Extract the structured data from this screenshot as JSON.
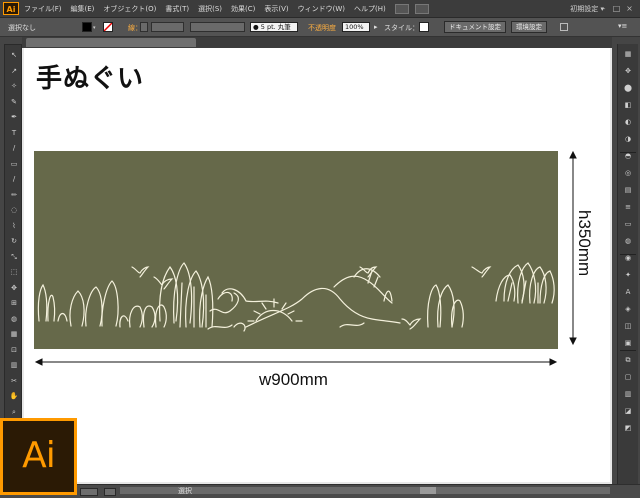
{
  "app": {
    "badge": "Ai",
    "logo_text": "Ai",
    "accent": "#ff9a00"
  },
  "menu": {
    "items": [
      "ファイル(F)",
      "編集(E)",
      "オブジェクト(O)",
      "書式(T)",
      "選択(S)",
      "効果(C)",
      "表示(V)",
      "ウィンドウ(W)",
      "ヘルプ(H)"
    ],
    "workspace": "初期設定 ▾",
    "window_controls": [
      "–",
      "□",
      "×"
    ]
  },
  "control_bar": {
    "selection": "選択なし",
    "stroke_label": "線：",
    "brush": "● 5 pt. 丸筆",
    "opacity_label": "不透明度",
    "opacity_value": "100%",
    "style_label": "スタイル：",
    "doc_setup": "ドキュメント設定",
    "prefs": "環境設定"
  },
  "artwork": {
    "title": "手ぬぐい",
    "width_label": "w900mm",
    "height_label": "h350mm",
    "towel_color": "#66694a",
    "line_color": "#f4f1dc"
  },
  "status": {
    "mode": "選択"
  },
  "tools": [
    "↖",
    "↗",
    "✧",
    "✎",
    "✒",
    "T",
    "/",
    "▭",
    "/",
    "✏",
    "◌",
    "⌇",
    "↻",
    "⤡",
    "⬚",
    "✥",
    "⊞",
    "◍",
    "▦",
    "⊡",
    "▥",
    "✂",
    "✋",
    "⌕"
  ],
  "panels": [
    "▦",
    "✥",
    "⬤",
    "◧",
    "◐",
    "◑",
    "◓",
    "◎",
    "▤",
    "≡",
    "▭",
    "◍",
    "◉",
    "✦",
    "A",
    "◈",
    "◫",
    "▣",
    "⧉",
    "▢",
    "▥",
    "◪",
    "◩"
  ]
}
